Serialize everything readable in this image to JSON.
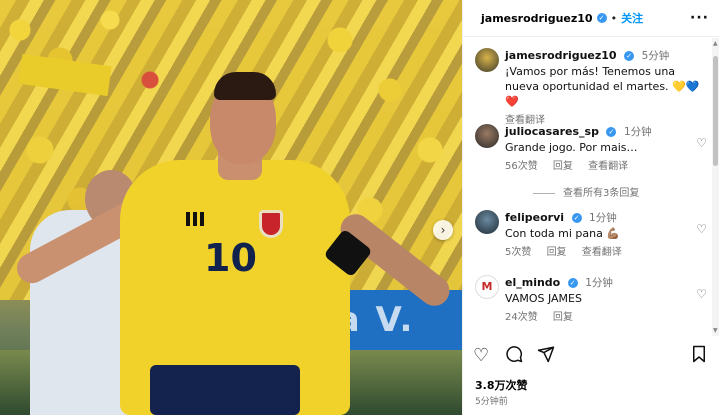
{
  "post": {
    "username": "jamesrodriguez10",
    "follow_label": "关注",
    "more_label": "···",
    "caption": {
      "username": "jamesrodriguez10",
      "time": "5分钟",
      "text": "¡Vamos por más! Tenemos una nueva oportunidad el martes. 💛💙❤️",
      "translate": "查看翻译"
    },
    "photo": {
      "number": "10",
      "banner_text": "ra V."
    },
    "comments": [
      {
        "username": "juliocasares_sp",
        "time": "1分钟",
        "text": "Grande jogo. Por mais…",
        "likes": "56次赞",
        "reply": "回复",
        "translate": "查看翻译"
      },
      {
        "username": "felipeorvi",
        "time": "1分钟",
        "text": "Con toda mi pana 💪🏽",
        "likes": "5次赞",
        "reply": "回复",
        "translate": "查看翻译"
      },
      {
        "username": "el_mindo",
        "time": "1分钟",
        "text": "VAMOS JAMES",
        "likes": "24次赞",
        "reply": "回复"
      }
    ],
    "view_replies": "查看所有3条回复",
    "likes_count": "3.8万次赞",
    "posted_ago": "5分钟前"
  },
  "colors": {
    "accent": "#0095f6",
    "verified": "#3897f0",
    "muted": "#737373"
  },
  "icons": [
    "verified-badge-icon",
    "more-options-icon",
    "heart-icon",
    "comment-icon",
    "share-icon",
    "bookmark-icon",
    "next-arrow-icon"
  ]
}
